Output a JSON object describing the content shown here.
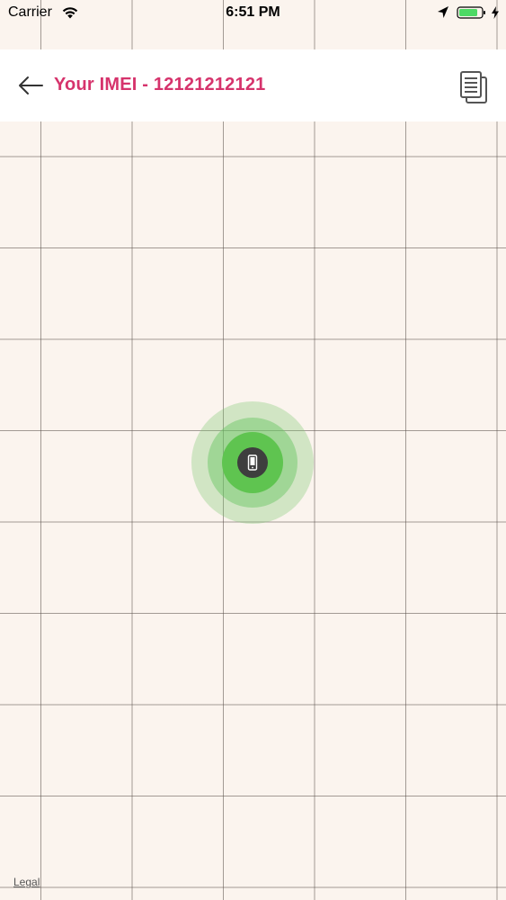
{
  "status_bar": {
    "carrier": "Carrier",
    "time": "6:51 PM",
    "wifi_icon": "wifi-icon",
    "location_icon": "location-arrow-icon",
    "battery_icon": "battery-icon",
    "battery_color": "#4cd964",
    "charging_icon": "charging-bolt-icon"
  },
  "header": {
    "title": "Your IMEI - 12121212121",
    "title_color": "#d6336c",
    "back_icon": "back-arrow-icon",
    "copy_icon": "copy-icon"
  },
  "map": {
    "background_color": "#fbf4ee",
    "marker": {
      "icon": "mobile-phone-icon",
      "color": "#5fc450"
    },
    "legal_label": "Legal"
  }
}
